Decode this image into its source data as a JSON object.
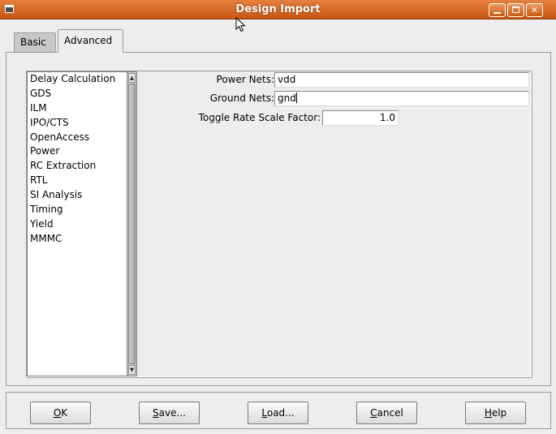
{
  "window": {
    "title": "Design Import"
  },
  "tabs": [
    {
      "label": "Basic"
    },
    {
      "label": "Advanced"
    }
  ],
  "categories": [
    "Delay Calculation",
    "GDS",
    "ILM",
    "IPO/CTS",
    "OpenAccess",
    "Power",
    "RC Extraction",
    "RTL",
    "SI Analysis",
    "Timing",
    "Yield",
    "MMMC"
  ],
  "form": {
    "power_nets_label": "Power Nets:",
    "power_nets_value": "vdd",
    "ground_nets_label": "Ground Nets:",
    "ground_nets_value": "gnd",
    "toggle_rate_label": "Toggle Rate Scale Factor:",
    "toggle_rate_value": "1.0"
  },
  "buttons": {
    "ok": {
      "mnemonic": "O",
      "rest": "K"
    },
    "save": {
      "mnemonic": "S",
      "rest": "ave..."
    },
    "load": {
      "mnemonic": "L",
      "rest": "oad..."
    },
    "cancel": {
      "mnemonic": "C",
      "rest": "ancel"
    },
    "help": {
      "mnemonic": "H",
      "rest": "elp"
    }
  }
}
